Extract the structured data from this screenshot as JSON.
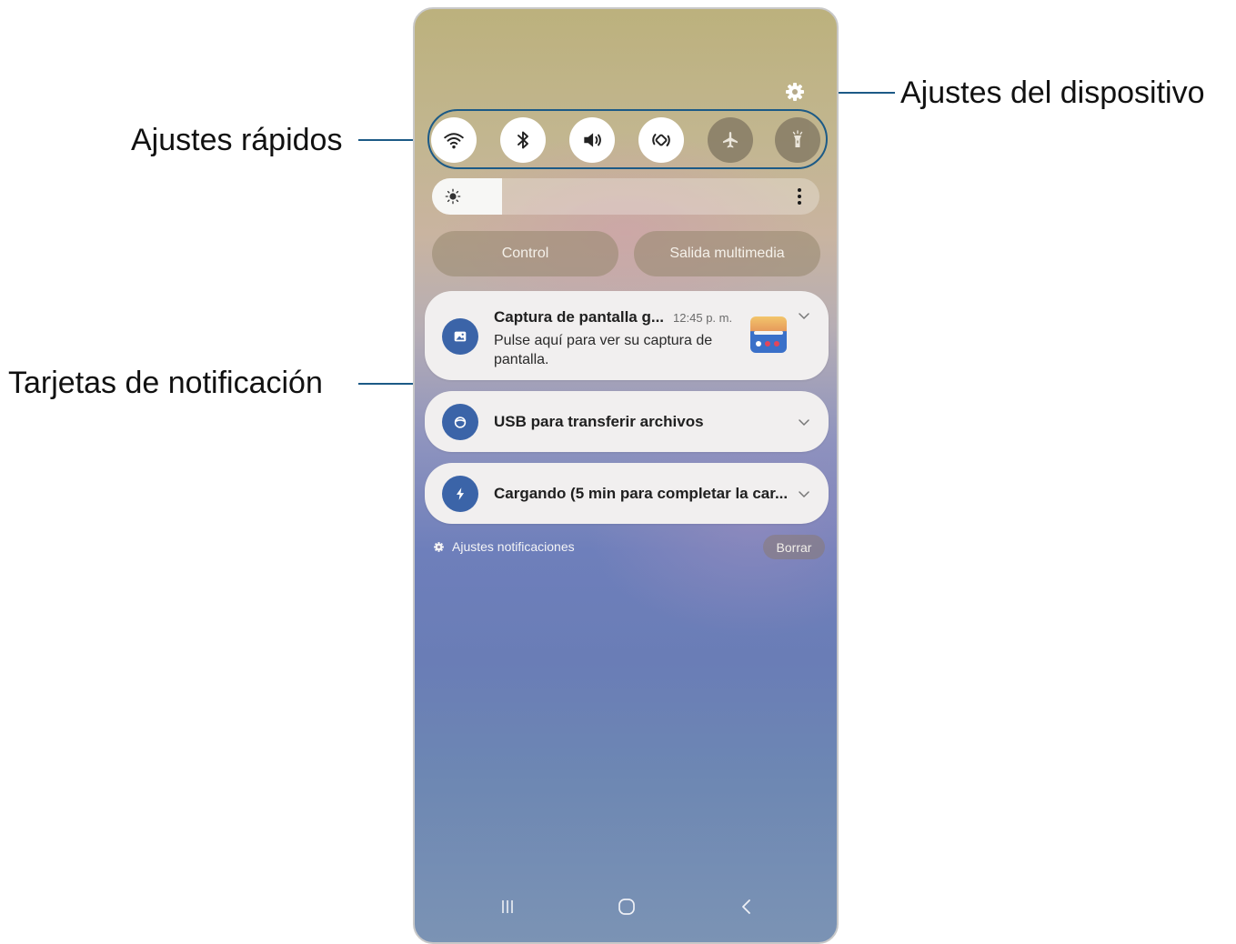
{
  "callouts": {
    "quick_settings": "Ajustes rápidos",
    "device_settings": "Ajustes del dispositivo",
    "notification_cards": "Tarjetas de notificación"
  },
  "quick_settings": [
    {
      "icon": "wifi-icon",
      "state": "on"
    },
    {
      "icon": "bluetooth-icon",
      "state": "on"
    },
    {
      "icon": "sound-icon",
      "state": "on"
    },
    {
      "icon": "auto-rotate-icon",
      "state": "on"
    },
    {
      "icon": "airplane-icon",
      "state": "off"
    },
    {
      "icon": "flashlight-icon",
      "state": "off"
    }
  ],
  "brightness": {
    "level": 0.18
  },
  "buttons": {
    "control": "Control",
    "media_output": "Salida multimedia"
  },
  "notifications": [
    {
      "title": "Captura de pantalla g...",
      "time": "12:45 p. m.",
      "body": "Pulse aquí para ver su captura de pantalla.",
      "icon": "image-icon"
    },
    {
      "title": "USB para transferir archivos",
      "icon": "usb-icon"
    },
    {
      "title": "Cargando (5 min para completar la car...",
      "icon": "charging-icon"
    }
  ],
  "footer": {
    "notification_settings": "Ajustes notificaciones",
    "clear": "Borrar"
  },
  "colors": {
    "callout_line": "#1c5a86",
    "app_icon_blue": "#3b64a8"
  }
}
